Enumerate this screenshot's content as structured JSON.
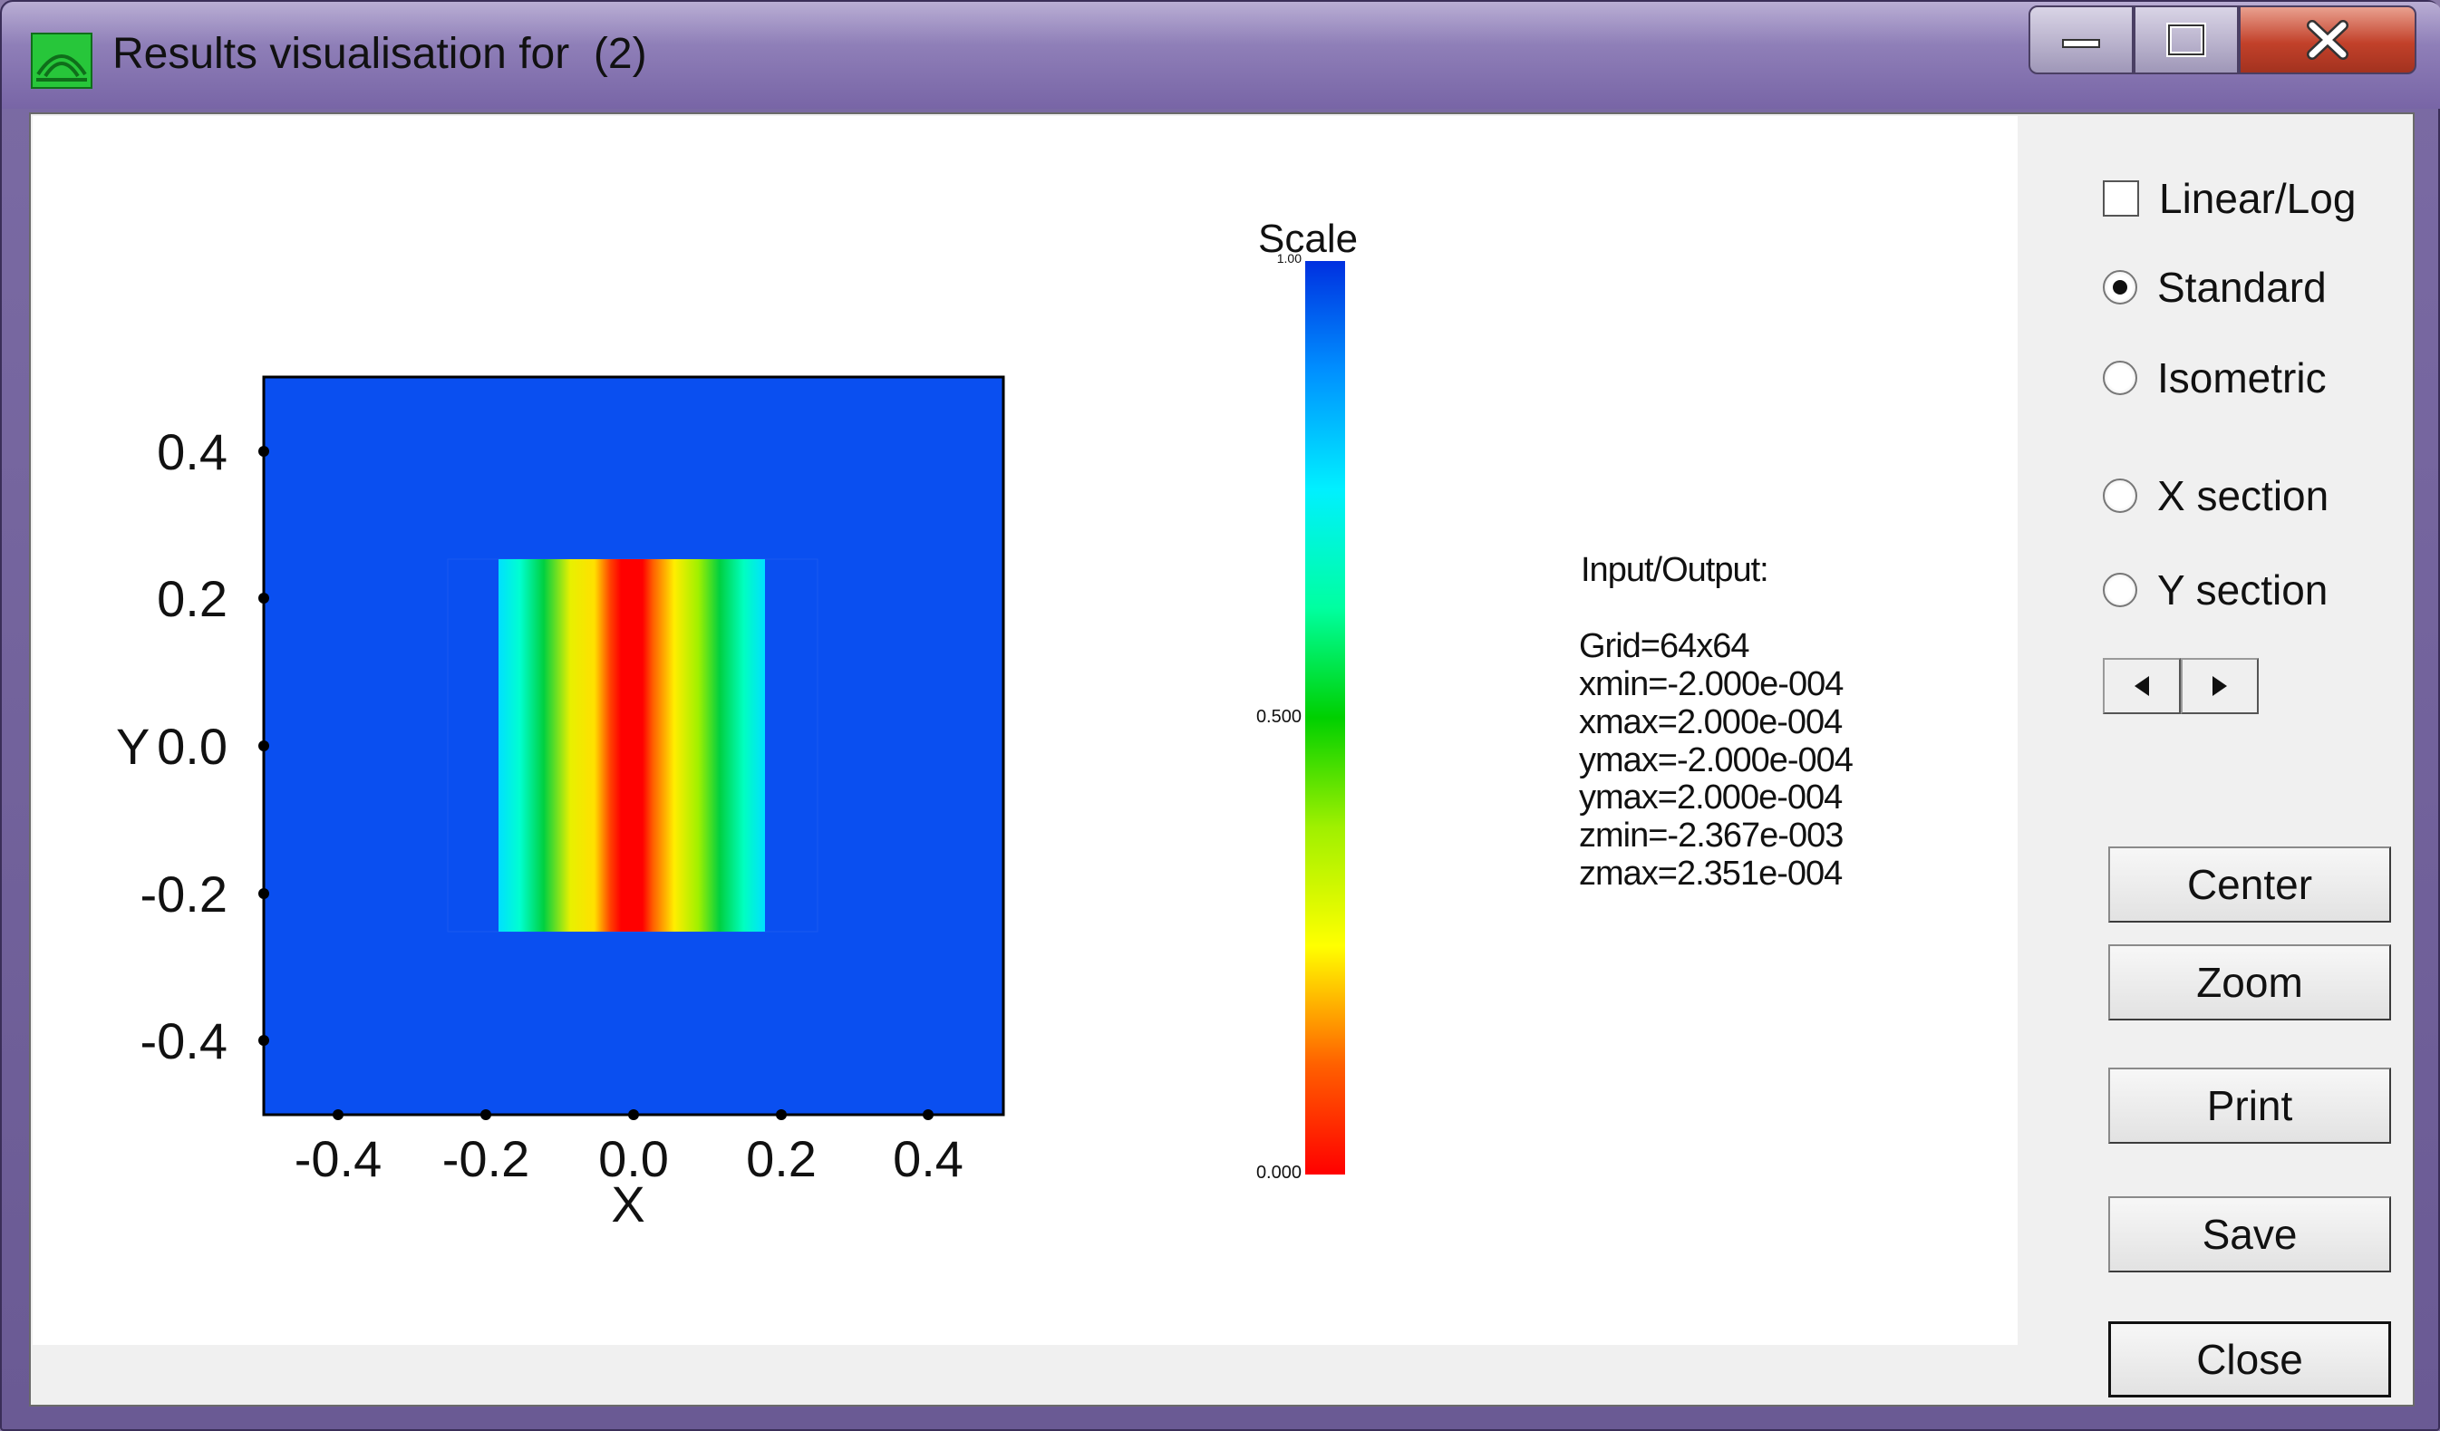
{
  "window": {
    "title": "Results visualisation for  (2)"
  },
  "plot": {
    "x_label": "X",
    "y_label": "Y",
    "x_ticks": [
      "-0.4",
      "-0.2",
      "0.0",
      "0.2",
      "0.4"
    ],
    "y_ticks": [
      "0.4",
      "0.2",
      "0.0",
      "-0.2",
      "-0.4"
    ],
    "background_color": "#0a4ff0"
  },
  "colorbar": {
    "title": "Scale",
    "top_label": "1.00",
    "mid_label": "0.500",
    "bottom_label": "0.000"
  },
  "info": {
    "heading": "Input/Output:",
    "lines": [
      "Grid=64x64",
      "xmin=-2.000e-004",
      "xmax=2.000e-004",
      "ymax=-2.000e-004",
      "ymax=2.000e-004",
      "zmin=-2.367e-003",
      "zmax=2.351e-004"
    ]
  },
  "controls": {
    "linear_log": {
      "label": "Linear/Log",
      "checked": false
    },
    "standard": {
      "label": "Standard",
      "selected": true
    },
    "isometric": {
      "label": "Isometric",
      "selected": false
    },
    "x_section": {
      "label": "X section",
      "selected": false
    },
    "y_section": {
      "label": "Y section",
      "selected": false
    }
  },
  "buttons": {
    "center": "Center",
    "zoom": "Zoom",
    "print": "Print",
    "save": "Save",
    "close": "Close"
  }
}
